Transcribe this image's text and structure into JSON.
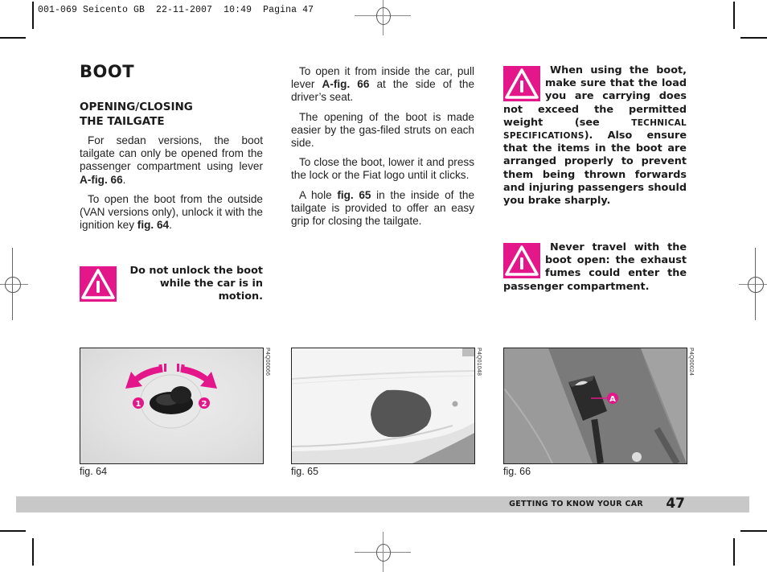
{
  "print_slug": {
    "file": "001-069 Seicento GB",
    "date": "22-11-2007",
    "time": "10:49",
    "page": "Pagina 47"
  },
  "header": {
    "title": "BOOT",
    "subtitle_line1": "OPENING/CLOSING",
    "subtitle_line2": "THE TAILGATE"
  },
  "column1": {
    "p1_text": "For sedan versions, the boot tailgate can only be opened from the passenger compartment using lever ",
    "p1_ref": "A-fig. 66",
    "p1_end": ".",
    "p2_text": "To open the boot from the outside (VAN versions only), unlock it with the ignition key ",
    "p2_ref": "fig. 64",
    "p2_end": "."
  },
  "column2": {
    "p1_text": "To open it from inside the car, pull lever ",
    "p1_ref": "A-fig. 66",
    "p1_end": " at the side of the driver’s seat.",
    "p2": "The opening of the boot is made easier by the gas-filed struts on each side.",
    "p3": "To close the boot, lower it and press the lock or the Fiat logo until it clicks.",
    "p4_start": "A hole ",
    "p4_ref": "fig. 65",
    "p4_end": " in the inside of the tailgate is provided to offer an easy grip for closing the tailgate."
  },
  "warnings": [
    {
      "icon": "warning-triangle-icon",
      "text": "Do not unlock the boot while the car is in motion."
    },
    {
      "icon": "warning-triangle-icon",
      "text_start": "When using the boot, make sure that the load you are carrying does not exceed the permitted weight (see ",
      "text_ref": "TECHNICAL SPECIFICATIONS",
      "text_end": "). Also ensure that the items in the boot are arranged properly to prevent them being thrown forwards and injuring passengers should you brake sharply."
    },
    {
      "icon": "warning-triangle-icon",
      "text": "Never travel with the boot open: the exhaust fumes could enter the passenger compartment."
    }
  ],
  "figures": [
    {
      "caption": "fig. 64",
      "code": "P4Q00066",
      "markers": [
        "1",
        "2"
      ]
    },
    {
      "caption": "fig. 65",
      "code": "P4Q01048"
    },
    {
      "caption": "fig. 66",
      "code": "P4Q00024",
      "markers": [
        "A"
      ]
    }
  ],
  "footer": {
    "section": "GETTING TO KNOW YOUR CAR",
    "page_number": "47"
  },
  "colors": {
    "warning_magenta": "#e3178a",
    "footer_bar": "#c8c8c8"
  }
}
